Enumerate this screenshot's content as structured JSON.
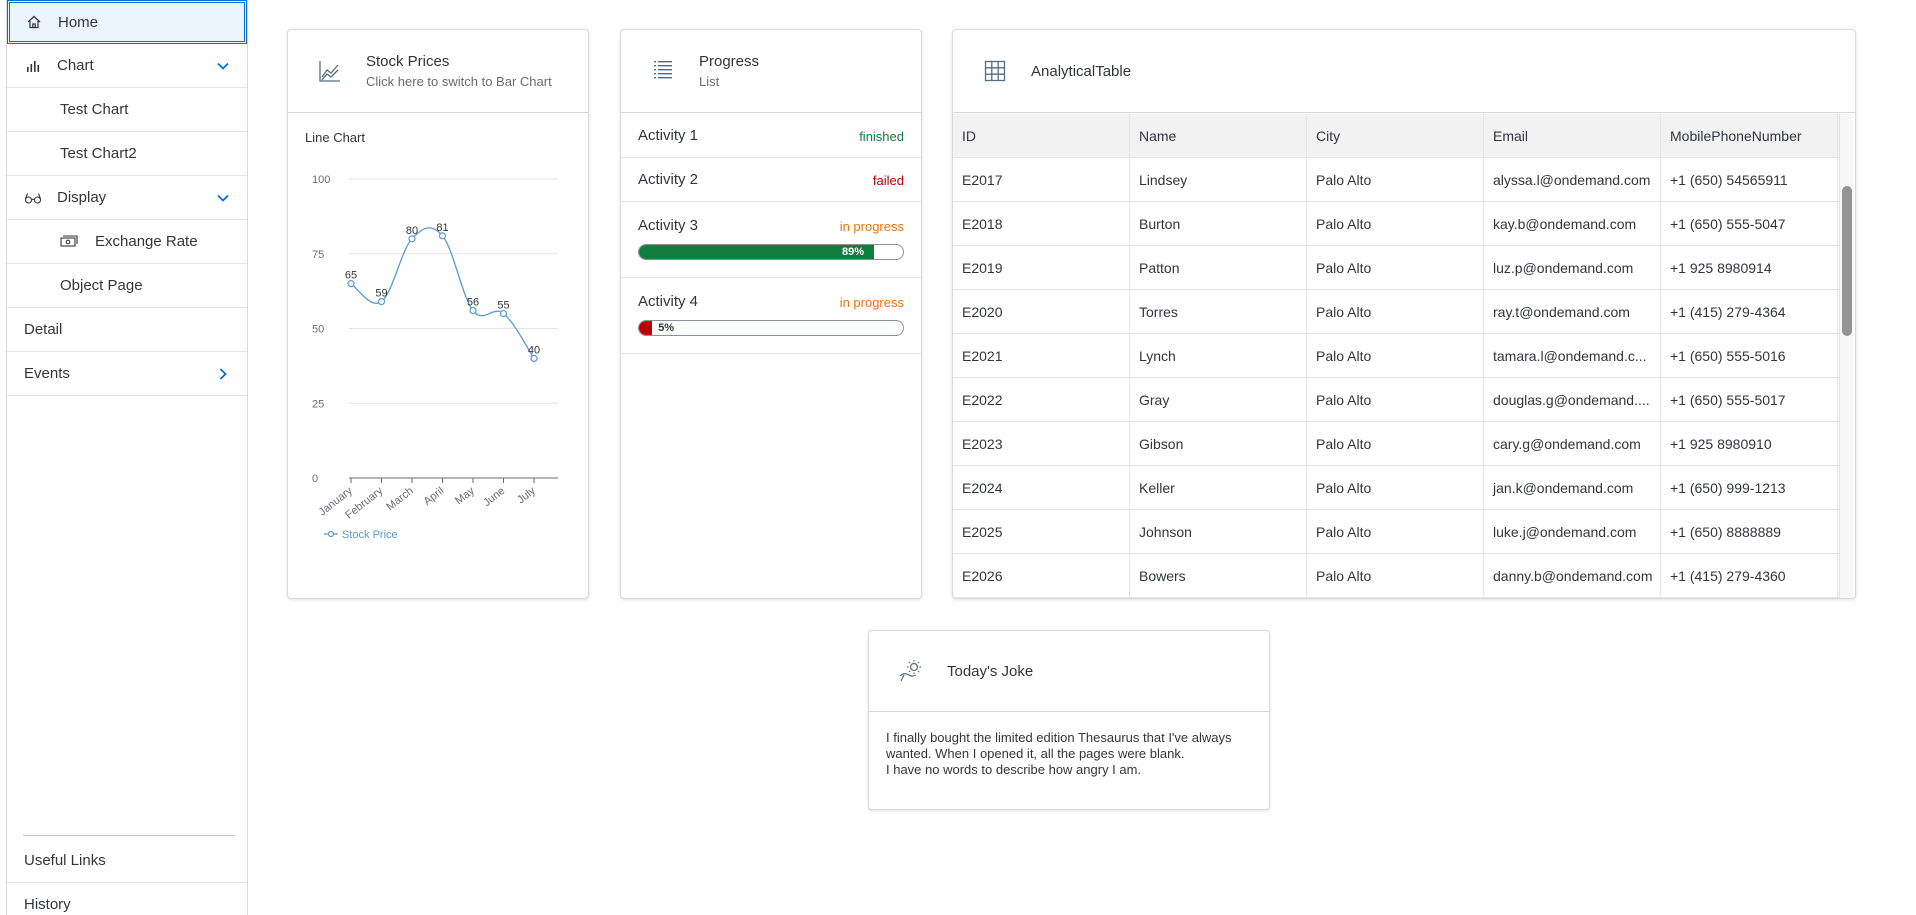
{
  "nav": {
    "items": [
      {
        "label": "Home",
        "icon": "home-icon"
      },
      {
        "label": "Chart",
        "icon": "bar-chart-icon"
      },
      {
        "label": "Test Chart"
      },
      {
        "label": "Test Chart2"
      },
      {
        "label": "Display",
        "icon": "glasses-icon"
      },
      {
        "label": "Exchange Rate",
        "icon": "money-bills-icon"
      },
      {
        "label": "Object Page"
      },
      {
        "label": "Detail"
      },
      {
        "label": "Events"
      }
    ],
    "footer": [
      {
        "label": "Useful Links"
      },
      {
        "label": "History"
      }
    ]
  },
  "stock_card": {
    "title": "Stock Prices",
    "subtitle": "Click here to switch to Bar Chart",
    "chart_label": "Line Chart",
    "icon": "line-chart-icon"
  },
  "chart_data": {
    "type": "line",
    "title": "Line Chart",
    "categories": [
      "January",
      "February",
      "March",
      "April",
      "May",
      "June",
      "July"
    ],
    "series": [
      {
        "name": "Stock Price",
        "values": [
          65,
          59,
          80,
          81,
          56,
          55,
          40
        ],
        "color": "#5899da"
      }
    ],
    "yticks": [
      0,
      25,
      50,
      75,
      100
    ],
    "ylim": [
      0,
      100
    ],
    "grid": true,
    "legend": "bottom-left"
  },
  "progress_card": {
    "title": "Progress",
    "subtitle": "List",
    "icon": "list-icon",
    "activities": [
      {
        "name": "Activity 1",
        "status": "finished"
      },
      {
        "name": "Activity 2",
        "status": "failed"
      },
      {
        "name": "Activity 3",
        "status": "in progress",
        "percent": 89,
        "percent_label": "89%"
      },
      {
        "name": "Activity 4",
        "status": "in progress",
        "percent": 5,
        "percent_label": "5%"
      }
    ]
  },
  "table_card": {
    "title": "AnalyticalTable",
    "icon": "table-icon",
    "columns": [
      "ID",
      "Name",
      "City",
      "Email",
      "MobilePhoneNumber"
    ],
    "rows": [
      [
        "E2017",
        "Lindsey",
        "Palo Alto",
        "alyssa.l@ondemand.com",
        "+1 (650) 54565911"
      ],
      [
        "E2018",
        "Burton",
        "Palo Alto",
        "kay.b@ondemand.com",
        "+1 (650) 555-5047"
      ],
      [
        "E2019",
        "Patton",
        "Palo Alto",
        "luz.p@ondemand.com",
        "+1 925 8980914"
      ],
      [
        "E2020",
        "Torres",
        "Palo Alto",
        "ray.t@ondemand.com",
        "+1 (415) 279-4364"
      ],
      [
        "E2021",
        "Lynch",
        "Palo Alto",
        "tamara.l@ondemand.c...",
        "+1 (650) 555-5016"
      ],
      [
        "E2022",
        "Gray",
        "Palo Alto",
        "douglas.g@ondemand....",
        "+1 (650) 555-5017"
      ],
      [
        "E2023",
        "Gibson",
        "Palo Alto",
        "cary.g@ondemand.com",
        "+1 925 8980910"
      ],
      [
        "E2024",
        "Keller",
        "Palo Alto",
        "jan.k@ondemand.com",
        "+1 (650) 999-1213"
      ],
      [
        "E2025",
        "Johnson",
        "Palo Alto",
        "luke.j@ondemand.com",
        "+1 (650) 8888889"
      ],
      [
        "E2026",
        "Bowers",
        "Palo Alto",
        "danny.b@ondemand.com",
        "+1 (415) 279-4360"
      ]
    ]
  },
  "joke_card": {
    "title": "Today's Joke",
    "icon": "weather-sun-icon",
    "line1": "I finally bought the limited edition Thesaurus that I've always wanted. When I opened it, all the pages were blank.",
    "line2": "I have no words to describe how angry I am."
  },
  "colors": {
    "accent": "#0a6ed1",
    "success": "#107e3e",
    "error": "#bb0000",
    "warning": "#e9730c",
    "chart_line": "#5899da"
  }
}
